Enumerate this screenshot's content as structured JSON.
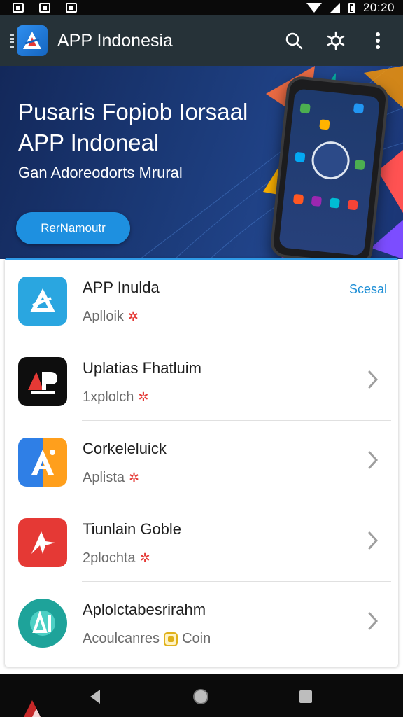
{
  "status_bar": {
    "time": "20:20"
  },
  "app_bar": {
    "title": "APP Indonesia",
    "icons": [
      "search-icon",
      "settings-icon",
      "more-vert-icon"
    ]
  },
  "banner": {
    "title_line1": "Pusaris Fopiob Iorsaal",
    "title_line2": "APP Indoneal",
    "subtitle": "Gan Adoreodorts Mrural",
    "button_label": "RerNamoutr"
  },
  "list": [
    {
      "title": "APP Inulda",
      "subtitle": "Aplloik",
      "badge": "star",
      "action": "Scesal",
      "icon_bg": "#2aa6e0",
      "icon_name": "app-logo-icon"
    },
    {
      "title": "Uplatias Fhatluim",
      "subtitle": "1xplolch",
      "badge": "star",
      "action": "",
      "icon_bg": "#0e0e0e",
      "icon_name": "ap-logo-icon"
    },
    {
      "title": "Corkeleluick",
      "subtitle": "Aplista",
      "badge": "star",
      "action": "",
      "icon_bg": "#2f7fe6",
      "icon_name": "a-logo-icon"
    },
    {
      "title": "Tiunlain Goble",
      "subtitle": "2plochta",
      "badge": "star",
      "action": "",
      "icon_bg": "#e53935",
      "icon_name": "arrow-logo-icon"
    },
    {
      "title": "Aplolctabesrirahm",
      "subtitle": "Acoulcanres",
      "badge": "coin",
      "badge_label": "Coin",
      "action": "",
      "icon_bg": "#1ea39a",
      "icon_name": "ai-logo-icon"
    }
  ],
  "nav": {
    "icons": [
      "back-icon",
      "home-icon",
      "recents-icon"
    ]
  },
  "colors": {
    "app_bar": "#263238",
    "accent": "#1e90e0",
    "banner": "#1b3a78"
  }
}
